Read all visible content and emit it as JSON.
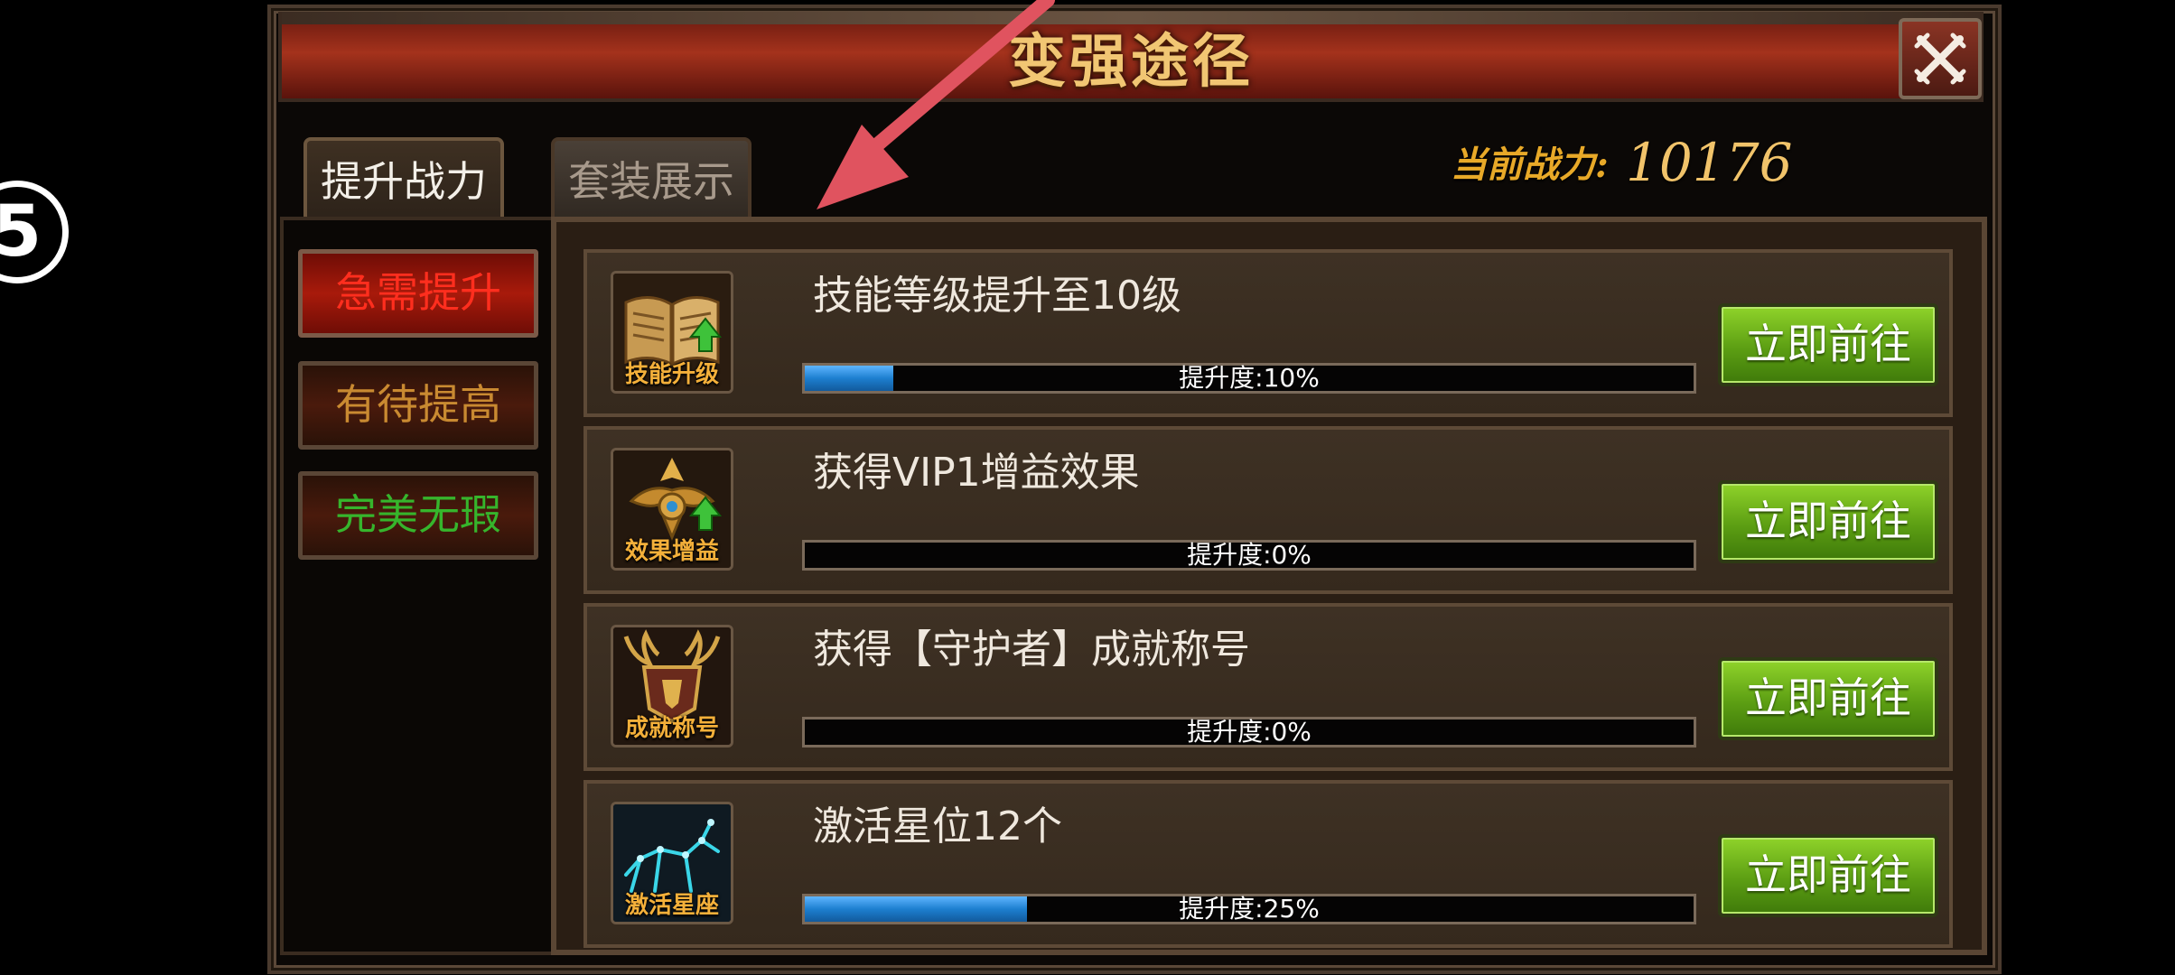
{
  "step_badge": "5",
  "window": {
    "title": "变强途径",
    "close_label": "close"
  },
  "tabs": [
    {
      "label": "提升战力",
      "active": true
    },
    {
      "label": "套装展示",
      "active": false
    }
  ],
  "power": {
    "label": "当前战力:",
    "value": "10176"
  },
  "categories": [
    {
      "label": "急需提升",
      "color": "#ff2e1e"
    },
    {
      "label": "有待提高",
      "color": "#c98a31"
    },
    {
      "label": "完美无瑕",
      "color": "#36b52c"
    }
  ],
  "items": [
    {
      "icon": "skill-book-icon",
      "caption": "技能升级",
      "title": "技能等级提升至10级",
      "progress_text": "提升度:10%",
      "progress": 0.1,
      "action": "立即前往"
    },
    {
      "icon": "vip-emblem-icon",
      "caption": "效果增益",
      "title": "获得VIP1增益效果",
      "progress_text": "提升度:0%",
      "progress": 0.0,
      "action": "立即前往"
    },
    {
      "icon": "achievement-crest-icon",
      "caption": "成就称号",
      "title": "获得【守护者】成就称号",
      "progress_text": "提升度:0%",
      "progress": 0.0,
      "action": "立即前往"
    },
    {
      "icon": "constellation-icon",
      "caption": "激活星座",
      "title": "激活星位12个",
      "progress_text": "提升度:25%",
      "progress": 0.25,
      "action": "立即前往"
    }
  ],
  "colors": {
    "arrow": "#e0535f",
    "button_green": "#5c9e13",
    "progress_blue": "#1d7fd0"
  }
}
